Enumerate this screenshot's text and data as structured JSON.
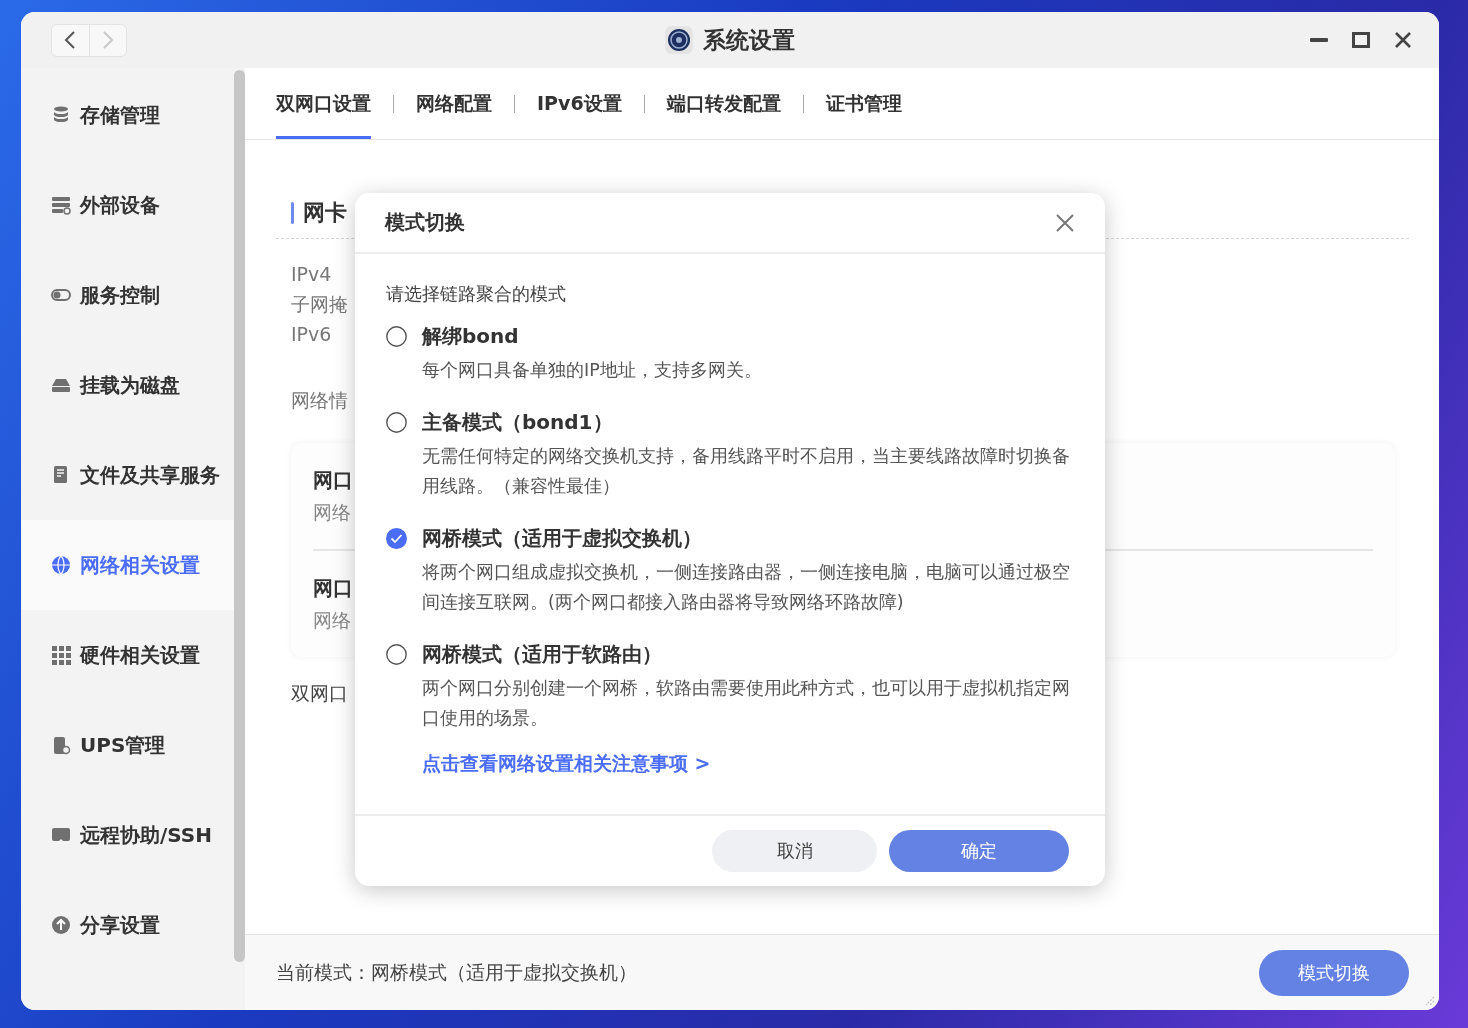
{
  "window": {
    "title": "系统设置"
  },
  "sidebar": {
    "items": [
      {
        "label": "存储管理",
        "selected": false
      },
      {
        "label": "外部设备",
        "selected": false
      },
      {
        "label": "服务控制",
        "selected": false
      },
      {
        "label": "挂载为磁盘",
        "selected": false
      },
      {
        "label": "文件及共享服务",
        "selected": false
      },
      {
        "label": "网络相关设置",
        "selected": true
      },
      {
        "label": "硬件相关设置",
        "selected": false
      },
      {
        "label": "UPS管理",
        "selected": false
      },
      {
        "label": "远程协助/SSH",
        "selected": false
      },
      {
        "label": "分享设置",
        "selected": false
      }
    ]
  },
  "tabs": [
    {
      "label": "双网口设置",
      "selected": true
    },
    {
      "label": "网络配置",
      "selected": false
    },
    {
      "label": "IPv6设置",
      "selected": false
    },
    {
      "label": "端口转发配置",
      "selected": false
    },
    {
      "label": "证书管理",
      "selected": false
    }
  ],
  "content": {
    "section_title": "网卡",
    "lines": [
      "IPv4",
      "子网掩",
      "IPv6"
    ],
    "network_label": "网络情",
    "ports": [
      {
        "name": "网口",
        "detail": "网络"
      },
      {
        "name": "网口",
        "detail": "网络"
      }
    ],
    "note": "双网口"
  },
  "dialog": {
    "title": "模式切换",
    "prompt": "请选择链路聚合的模式",
    "options": [
      {
        "title": "解绑bond",
        "description": "每个网口具备单独的IP地址，支持多网关。",
        "selected": false
      },
      {
        "title": "主备模式（bond1）",
        "description": "无需任何特定的网络交换机支持，备用线路平时不启用，当主要线路故障时切换备用线路。（兼容性最佳）",
        "selected": false
      },
      {
        "title": "网桥模式（适用于虚拟交换机）",
        "description": "将两个网口组成虚拟交换机，一侧连接路由器，一侧连接电脑，电脑可以通过极空间连接互联网。(两个网口都接入路由器将导致网络环路故障)",
        "selected": true
      },
      {
        "title": "网桥模式（适用于软路由）",
        "description": "两个网口分别创建一个网桥，软路由需要使用此种方式，也可以用于虚拟机指定网口使用的场景。",
        "selected": false
      }
    ],
    "link": "点击查看网络设置相关注意事项 >",
    "buttons": [
      {
        "label": "取消",
        "kind": "secondary"
      },
      {
        "label": "确定",
        "kind": "primary"
      }
    ]
  },
  "status_bar": {
    "text": "当前模式：网桥模式（适用于虚拟交换机）",
    "button": "模式切换"
  }
}
